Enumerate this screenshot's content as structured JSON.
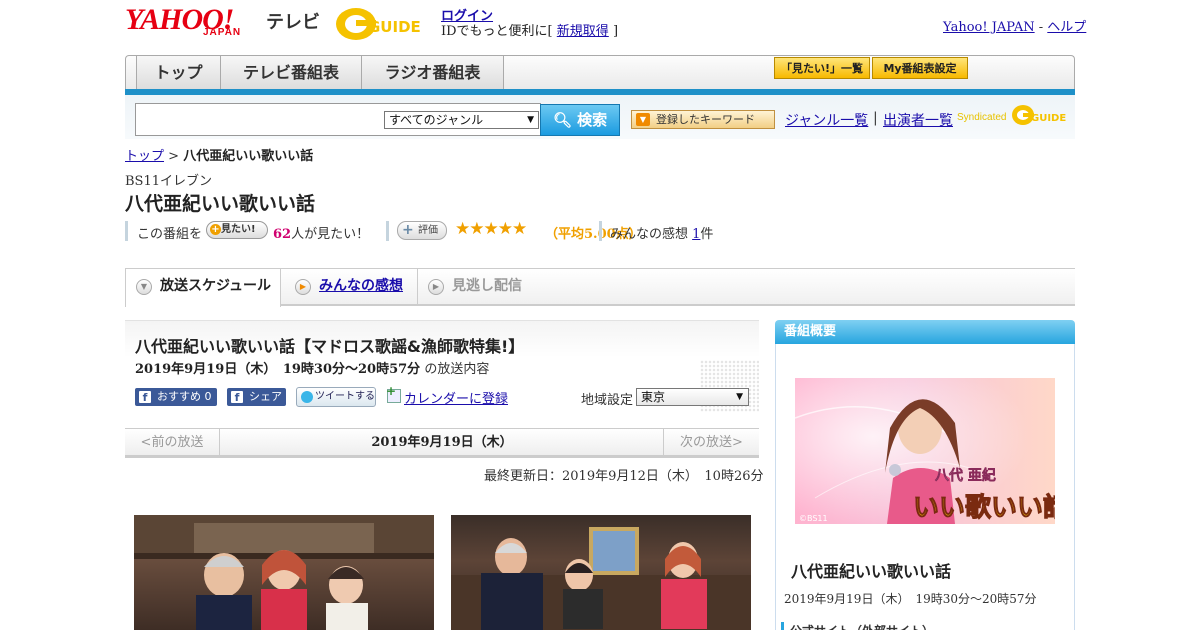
{
  "header": {
    "logo_yahoo": "YAHOO!",
    "logo_japan": "JAPAN",
    "logo_tv": "テレビ",
    "gguide_logo": "GUIDE",
    "login": "ログイン",
    "id_prefix": "IDでもっと便利に[",
    "signup": "新規取得",
    "id_suffix": "]",
    "yahoo_japan": "Yahoo! JAPAN",
    "sep": " - ",
    "help": "ヘルプ"
  },
  "nav": {
    "tabs": [
      "トップ",
      "テレビ番組表",
      "ラジオ番組表"
    ],
    "mitai_list": "「見たい!」一覧",
    "my_schedule": "My番組表設定"
  },
  "search": {
    "genre_selected": "すべてのジャンル",
    "search_button": "検索",
    "keyword_button": "登録したキーワード",
    "genre_list": "ジャンル一覧",
    "divider": "|",
    "cast_list": "出演者一覧",
    "syndicated": "Syndicated",
    "synd_logo": "GUIDE"
  },
  "breadcrumb": {
    "top": "トップ",
    "sep": " > ",
    "current": "八代亜紀いい歌いい話"
  },
  "program": {
    "channel": "BS11イレブン",
    "title": "八代亜紀いい歌いい話",
    "want_prefix": "この番組を",
    "mitai_chip": "見たい!",
    "want_count": "62",
    "want_suffix": "人が見たい！",
    "hyoka_chip": "評価",
    "stars": "★★★★★",
    "avg": "（平均5.00点）",
    "kanso_prefix": "みんなの感想 ",
    "kanso_count": "1",
    "kanso_suffix": "件"
  },
  "tabs": {
    "schedule": "放送スケジュール",
    "kanso": "みんなの感想",
    "minogashi": "見逃し配信"
  },
  "episode": {
    "title": "八代亜紀いい歌いい話【マドロス歌謡&漁師歌特集!】",
    "datetime": "2019年9月19日（木）　19時30分～20時57分",
    "datetime_suffix": " の放送内容",
    "osusume": "おすすめ 0",
    "share": "シェア",
    "tweet": "ツイートする",
    "calendar": "カレンダーに登録",
    "region_label": "地域設定",
    "region_value": "東京",
    "prev": "<前の放送",
    "current_date": "2019年9月19日（木）",
    "next": "次の放送>",
    "updated": "最終更新日：2019年9月12日（木）　10時26分"
  },
  "sidebar": {
    "head": "番組概要",
    "img_name": "八代 亜紀",
    "img_title": "いい歌いい話",
    "img_credit": "©BS11",
    "title": "八代亜紀いい歌いい話",
    "date": "2019年9月19日（木）　19時30分～20時57分",
    "official": "公式サイト（外部サイト）"
  }
}
